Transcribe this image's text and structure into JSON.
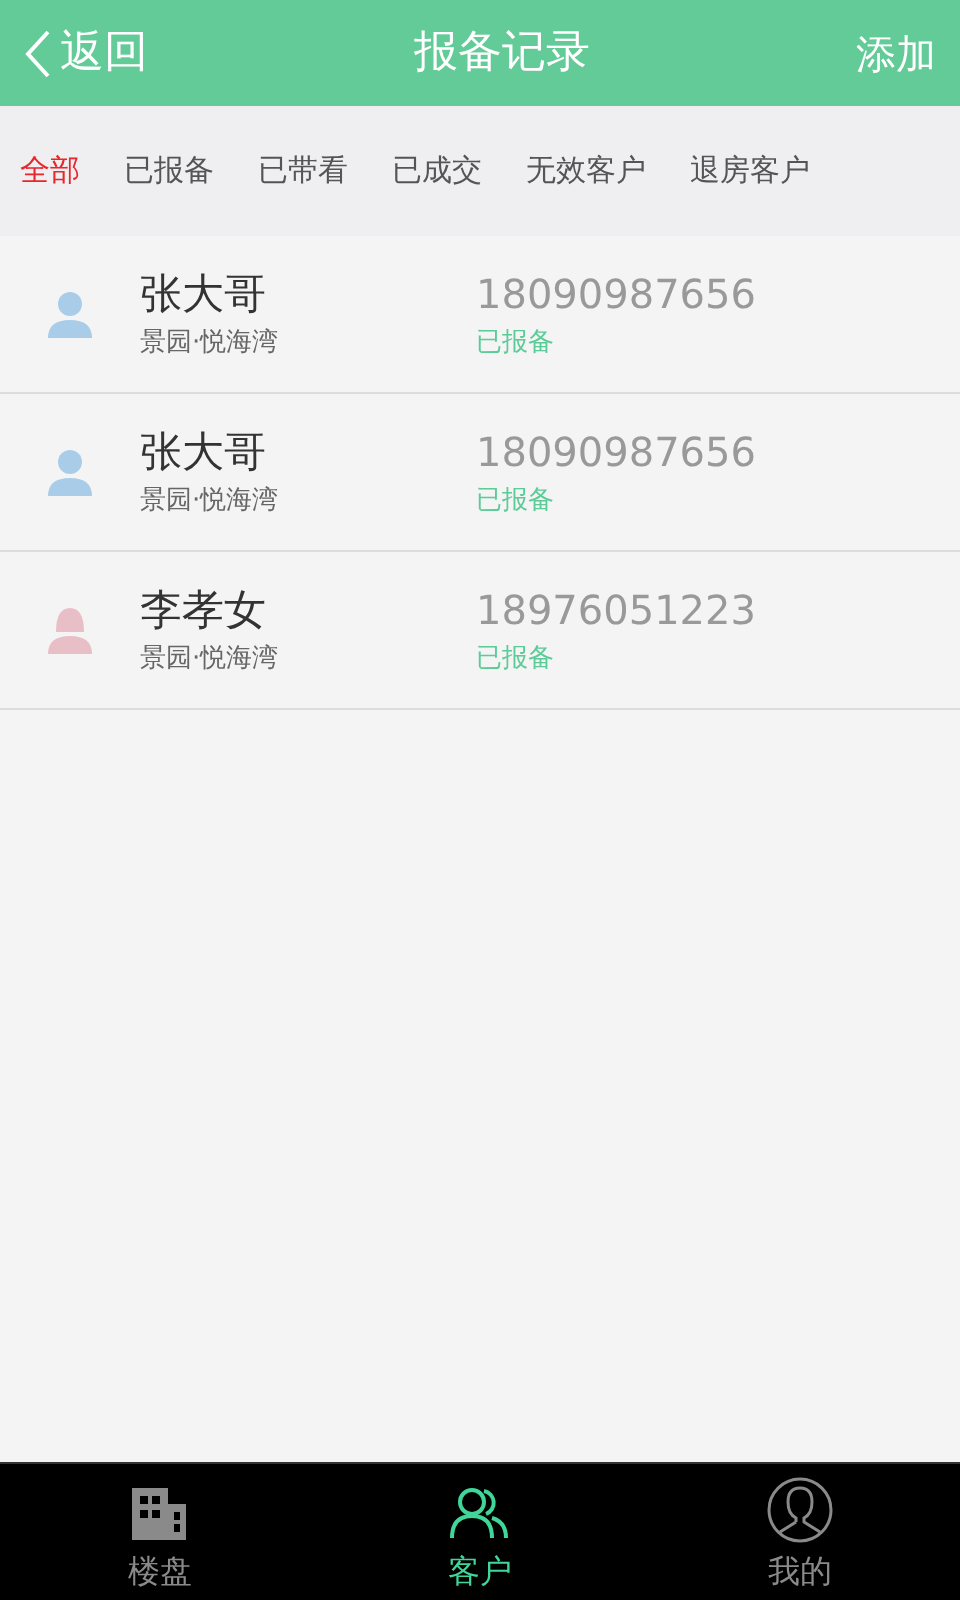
{
  "header": {
    "back": "返回",
    "title": "报备记录",
    "action": "添加"
  },
  "filters": [
    {
      "label": "全部",
      "selected": true
    },
    {
      "label": "已报备",
      "selected": false
    },
    {
      "label": "已带看",
      "selected": false
    },
    {
      "label": "已成交",
      "selected": false
    },
    {
      "label": "无效客户",
      "selected": false
    },
    {
      "label": "退房客户",
      "selected": false
    }
  ],
  "records": [
    {
      "kind": "male",
      "name": "张大哥",
      "project": "景园·悦海湾",
      "phone": "18090987656",
      "status": "已报备"
    },
    {
      "kind": "male",
      "name": "张大哥",
      "project": "景园·悦海湾",
      "phone": "18090987656",
      "status": "已报备"
    },
    {
      "kind": "female",
      "name": "李孝女",
      "project": "景园·悦海湾",
      "phone": "18976051223",
      "status": "已报备"
    }
  ],
  "tabbar": [
    {
      "kind": "building",
      "label": "楼盘",
      "selected": false
    },
    {
      "kind": "people",
      "label": "客户",
      "selected": true
    },
    {
      "kind": "profile",
      "label": "我的",
      "selected": false
    }
  ]
}
